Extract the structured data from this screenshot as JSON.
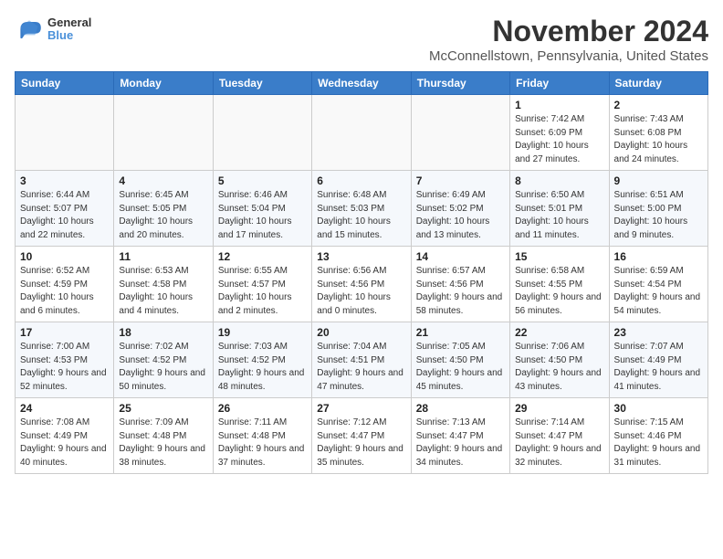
{
  "header": {
    "logo": {
      "line1": "General",
      "line2": "Blue"
    },
    "title": "November 2024",
    "location": "McConnellstown, Pennsylvania, United States"
  },
  "calendar": {
    "days_of_week": [
      "Sunday",
      "Monday",
      "Tuesday",
      "Wednesday",
      "Thursday",
      "Friday",
      "Saturday"
    ],
    "weeks": [
      [
        {
          "day": "",
          "info": ""
        },
        {
          "day": "",
          "info": ""
        },
        {
          "day": "",
          "info": ""
        },
        {
          "day": "",
          "info": ""
        },
        {
          "day": "",
          "info": ""
        },
        {
          "day": "1",
          "info": "Sunrise: 7:42 AM\nSunset: 6:09 PM\nDaylight: 10 hours and 27 minutes."
        },
        {
          "day": "2",
          "info": "Sunrise: 7:43 AM\nSunset: 6:08 PM\nDaylight: 10 hours and 24 minutes."
        }
      ],
      [
        {
          "day": "3",
          "info": "Sunrise: 6:44 AM\nSunset: 5:07 PM\nDaylight: 10 hours and 22 minutes."
        },
        {
          "day": "4",
          "info": "Sunrise: 6:45 AM\nSunset: 5:05 PM\nDaylight: 10 hours and 20 minutes."
        },
        {
          "day": "5",
          "info": "Sunrise: 6:46 AM\nSunset: 5:04 PM\nDaylight: 10 hours and 17 minutes."
        },
        {
          "day": "6",
          "info": "Sunrise: 6:48 AM\nSunset: 5:03 PM\nDaylight: 10 hours and 15 minutes."
        },
        {
          "day": "7",
          "info": "Sunrise: 6:49 AM\nSunset: 5:02 PM\nDaylight: 10 hours and 13 minutes."
        },
        {
          "day": "8",
          "info": "Sunrise: 6:50 AM\nSunset: 5:01 PM\nDaylight: 10 hours and 11 minutes."
        },
        {
          "day": "9",
          "info": "Sunrise: 6:51 AM\nSunset: 5:00 PM\nDaylight: 10 hours and 9 minutes."
        }
      ],
      [
        {
          "day": "10",
          "info": "Sunrise: 6:52 AM\nSunset: 4:59 PM\nDaylight: 10 hours and 6 minutes."
        },
        {
          "day": "11",
          "info": "Sunrise: 6:53 AM\nSunset: 4:58 PM\nDaylight: 10 hours and 4 minutes."
        },
        {
          "day": "12",
          "info": "Sunrise: 6:55 AM\nSunset: 4:57 PM\nDaylight: 10 hours and 2 minutes."
        },
        {
          "day": "13",
          "info": "Sunrise: 6:56 AM\nSunset: 4:56 PM\nDaylight: 10 hours and 0 minutes."
        },
        {
          "day": "14",
          "info": "Sunrise: 6:57 AM\nSunset: 4:56 PM\nDaylight: 9 hours and 58 minutes."
        },
        {
          "day": "15",
          "info": "Sunrise: 6:58 AM\nSunset: 4:55 PM\nDaylight: 9 hours and 56 minutes."
        },
        {
          "day": "16",
          "info": "Sunrise: 6:59 AM\nSunset: 4:54 PM\nDaylight: 9 hours and 54 minutes."
        }
      ],
      [
        {
          "day": "17",
          "info": "Sunrise: 7:00 AM\nSunset: 4:53 PM\nDaylight: 9 hours and 52 minutes."
        },
        {
          "day": "18",
          "info": "Sunrise: 7:02 AM\nSunset: 4:52 PM\nDaylight: 9 hours and 50 minutes."
        },
        {
          "day": "19",
          "info": "Sunrise: 7:03 AM\nSunset: 4:52 PM\nDaylight: 9 hours and 48 minutes."
        },
        {
          "day": "20",
          "info": "Sunrise: 7:04 AM\nSunset: 4:51 PM\nDaylight: 9 hours and 47 minutes."
        },
        {
          "day": "21",
          "info": "Sunrise: 7:05 AM\nSunset: 4:50 PM\nDaylight: 9 hours and 45 minutes."
        },
        {
          "day": "22",
          "info": "Sunrise: 7:06 AM\nSunset: 4:50 PM\nDaylight: 9 hours and 43 minutes."
        },
        {
          "day": "23",
          "info": "Sunrise: 7:07 AM\nSunset: 4:49 PM\nDaylight: 9 hours and 41 minutes."
        }
      ],
      [
        {
          "day": "24",
          "info": "Sunrise: 7:08 AM\nSunset: 4:49 PM\nDaylight: 9 hours and 40 minutes."
        },
        {
          "day": "25",
          "info": "Sunrise: 7:09 AM\nSunset: 4:48 PM\nDaylight: 9 hours and 38 minutes."
        },
        {
          "day": "26",
          "info": "Sunrise: 7:11 AM\nSunset: 4:48 PM\nDaylight: 9 hours and 37 minutes."
        },
        {
          "day": "27",
          "info": "Sunrise: 7:12 AM\nSunset: 4:47 PM\nDaylight: 9 hours and 35 minutes."
        },
        {
          "day": "28",
          "info": "Sunrise: 7:13 AM\nSunset: 4:47 PM\nDaylight: 9 hours and 34 minutes."
        },
        {
          "day": "29",
          "info": "Sunrise: 7:14 AM\nSunset: 4:47 PM\nDaylight: 9 hours and 32 minutes."
        },
        {
          "day": "30",
          "info": "Sunrise: 7:15 AM\nSunset: 4:46 PM\nDaylight: 9 hours and 31 minutes."
        }
      ]
    ]
  }
}
